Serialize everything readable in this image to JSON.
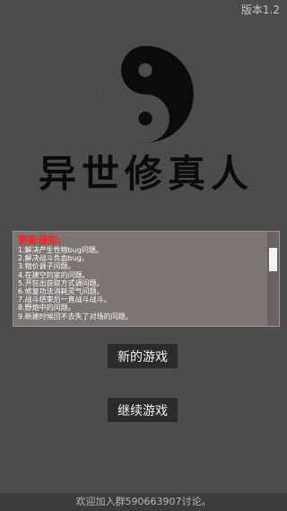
{
  "header": {
    "version": "版本1.2"
  },
  "emblem": {
    "icon": "yin-yang-icon"
  },
  "title": {
    "text": "异世修真人"
  },
  "notice": {
    "heading": "更新通知:",
    "lines": [
      "1.解决产生性物bug问题。",
      "2.解决战斗负血bug。",
      "3.物价调子问题。",
      "4.在建空的家的问题。",
      "5.开狂出获取方式调问题。",
      "6.修复功法消耗灵气问题。",
      "7.战斗结束后一直战斗战斗。",
      "8.野炮中的问题。",
      "9.新建时候回不去失了对场的问题。"
    ]
  },
  "buttons": {
    "new_game": "新的游戏",
    "continue_game": "继续游戏"
  },
  "footer": {
    "text": "欢迎加入群590663907讨论。"
  },
  "colors": {
    "background": "#4c4c4c",
    "notice_heading": "#ff1e1e",
    "button": "#2b2b2b"
  }
}
